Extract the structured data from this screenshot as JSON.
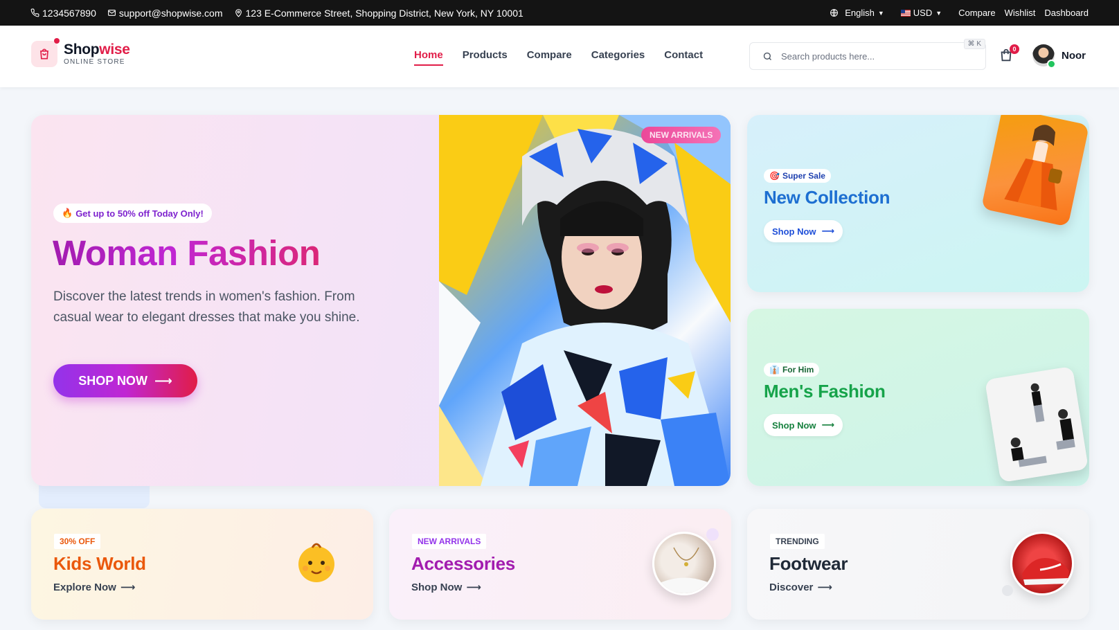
{
  "topbar": {
    "phone": "1234567890",
    "email": "support@shopwise.com",
    "address": "123 E-Commerce Street, Shopping District, New York, NY 10001",
    "language": "English",
    "currency": "USD",
    "links": [
      "Compare",
      "Wishlist",
      "Dashboard"
    ]
  },
  "header": {
    "logo_part1": "Shop",
    "logo_part2": "wise",
    "logo_sub": "ONLINE STORE",
    "nav": [
      "Home",
      "Products",
      "Compare",
      "Categories",
      "Contact"
    ],
    "active_nav": "Home",
    "search_placeholder": "Search products here...",
    "search_shortcut": "⌘ K",
    "cart_count": "0",
    "user_name": "Noor"
  },
  "hero": {
    "badge": "Get up to 50% off Today Only!",
    "badge_icon": "fire-emoji",
    "title": "Woman Fashion",
    "description": "Discover the latest trends in women's fashion. From casual wear to elegant dresses that make you shine.",
    "button": "SHOP NOW",
    "image_tag": "NEW ARRIVALS"
  },
  "side_cards": [
    {
      "tag_icon": "target-emoji",
      "tag": "Super Sale",
      "title": "New Collection",
      "button": "Shop Now"
    },
    {
      "tag_icon": "man-emoji",
      "tag": "For Him",
      "title": "Men's Fashion",
      "button": "Shop Now"
    }
  ],
  "bottom_cards": [
    {
      "tag": "30% OFF",
      "title": "Kids World",
      "link": "Explore Now"
    },
    {
      "tag": "NEW ARRIVALS",
      "title": "Accessories",
      "link": "Shop Now"
    },
    {
      "tag": "TRENDING",
      "title": "Footwear",
      "link": "Discover"
    }
  ],
  "colors": {
    "brand": "#e11d48",
    "hero_gradient_start": "#9333ea",
    "hero_gradient_end": "#e11d48",
    "collection_blue": "#1d6fd1",
    "men_green": "#16a34a",
    "kids_orange": "#ea580c",
    "accessories_purple": "#a21caf"
  }
}
